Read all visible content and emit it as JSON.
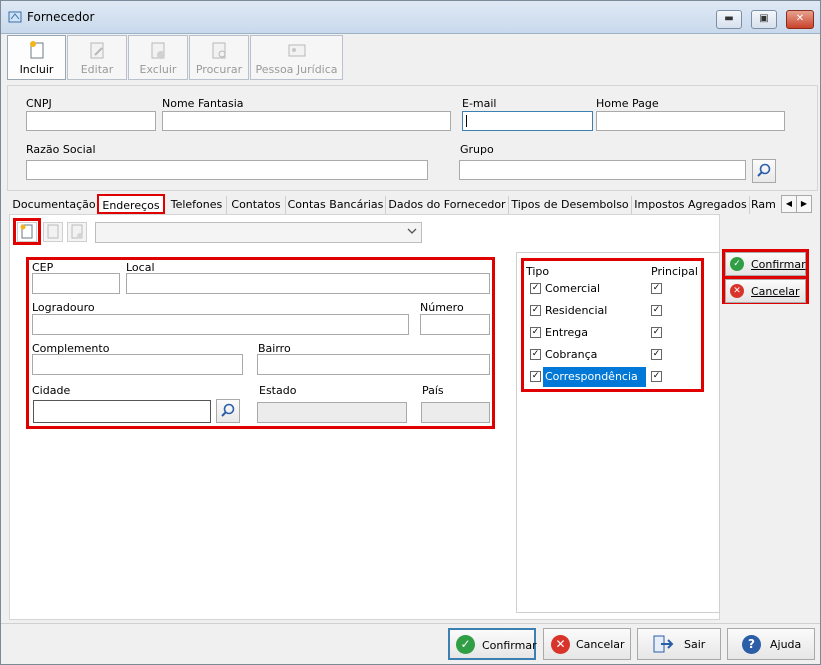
{
  "window": {
    "title": "Fornecedor"
  },
  "toolbar": {
    "buttons": [
      {
        "label": "Incluir",
        "enabled": true
      },
      {
        "label": "Editar",
        "enabled": false
      },
      {
        "label": "Excluir",
        "enabled": false
      },
      {
        "label": "Procurar",
        "enabled": false
      },
      {
        "label": "Pessoa Jurídica",
        "enabled": false
      }
    ]
  },
  "header": {
    "cnpj_label": "CNPJ",
    "nome_fantasia_label": "Nome Fantasia",
    "email_label": "E-mail",
    "home_page_label": "Home Page",
    "razao_social_label": "Razão Social",
    "grupo_label": "Grupo"
  },
  "tabs": [
    {
      "label": "Documentação",
      "active": false
    },
    {
      "label": "Endereços",
      "active": true
    },
    {
      "label": "Telefones",
      "active": false
    },
    {
      "label": "Contatos",
      "active": false
    },
    {
      "label": "Contas Bancárias",
      "active": false
    },
    {
      "label": "Dados do Fornecedor",
      "active": false
    },
    {
      "label": "Tipos de Desembolso",
      "active": false
    },
    {
      "label": "Impostos Agregados",
      "active": false
    },
    {
      "label": "Ram",
      "active": false
    }
  ],
  "address": {
    "cep_label": "CEP",
    "local_label": "Local",
    "logradouro_label": "Logradouro",
    "numero_label": "Número",
    "complemento_label": "Complemento",
    "bairro_label": "Bairro",
    "cidade_label": "Cidade",
    "estado_label": "Estado",
    "pais_label": "País"
  },
  "tipo_grid": {
    "col_tipo": "Tipo",
    "col_principal": "Principal",
    "rows": [
      {
        "tipo": "Comercial",
        "tipo_checked": true,
        "principal_checked": true,
        "selected": false
      },
      {
        "tipo": "Residencial",
        "tipo_checked": true,
        "principal_checked": true,
        "selected": false
      },
      {
        "tipo": "Entrega",
        "tipo_checked": true,
        "principal_checked": true,
        "selected": false
      },
      {
        "tipo": "Cobrança",
        "tipo_checked": true,
        "principal_checked": true,
        "selected": false
      },
      {
        "tipo": "Correspondência",
        "tipo_checked": true,
        "principal_checked": true,
        "selected": true
      }
    ]
  },
  "side_buttons": {
    "confirmar": "Confirmar",
    "cancelar": "Cancelar"
  },
  "bottom_buttons": {
    "confirmar": "Confirmar",
    "cancelar": "Cancelar",
    "sair": "Sair",
    "ajuda": "Ajuda"
  },
  "colors": {
    "accent": "#e00000",
    "selection": "#0078d7",
    "confirm": "#2f9e44",
    "cancel": "#d9342b",
    "help": "#2b5ea7"
  }
}
